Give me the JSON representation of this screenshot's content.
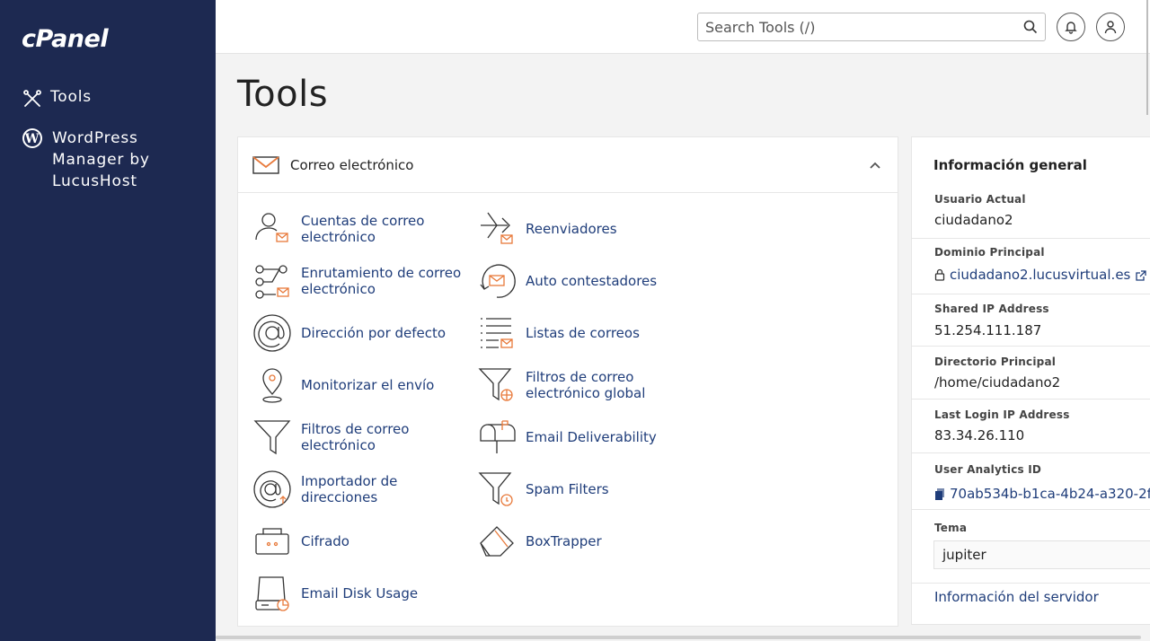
{
  "sidebar": {
    "logo": "cPanel",
    "items": [
      {
        "label": "Tools",
        "icon": "tools-icon"
      },
      {
        "label": "WordPress Manager by LucusHost",
        "icon": "wordpress-icon"
      }
    ]
  },
  "topbar": {
    "search_placeholder": "Search Tools (/)"
  },
  "page_title": "Tools",
  "email_section": {
    "title": "Correo electrónico",
    "tools": [
      {
        "label": "Cuentas de correo electrónico",
        "icon": "email-accounts-icon"
      },
      {
        "label": "Reenviadores",
        "icon": "forwarders-icon"
      },
      {
        "label": "Enrutamiento de correo electrónico",
        "icon": "email-routing-icon"
      },
      {
        "label": "Auto contestadores",
        "icon": "autoresponders-icon"
      },
      {
        "label": "Dirección por defecto",
        "icon": "default-address-icon"
      },
      {
        "label": "Listas de correos",
        "icon": "mailing-lists-icon"
      },
      {
        "label": "Monitorizar el envío",
        "icon": "track-delivery-icon"
      },
      {
        "label": "Filtros de correo electrónico global",
        "icon": "global-filters-icon"
      },
      {
        "label": "Filtros de correo electrónico",
        "icon": "email-filters-icon"
      },
      {
        "label": "Email Deliverability",
        "icon": "mailbox-icon"
      },
      {
        "label": "Importador de direcciones",
        "icon": "address-importer-icon"
      },
      {
        "label": "Spam Filters",
        "icon": "spam-filters-icon"
      },
      {
        "label": "Cifrado",
        "icon": "encryption-icon"
      },
      {
        "label": "BoxTrapper",
        "icon": "boxtrapper-icon"
      },
      {
        "label": "Email Disk Usage",
        "icon": "disk-usage-icon"
      }
    ]
  },
  "info": {
    "title": "Información general",
    "current_user_label": "Usuario Actual",
    "current_user": "ciudadano2",
    "primary_domain_label": "Dominio Principal",
    "primary_domain": "ciudadano2.lucusvirtual.es",
    "shared_ip_label": "Shared IP Address",
    "shared_ip": "51.254.111.187",
    "home_dir_label": "Directorio Principal",
    "home_dir": "/home/ciudadano2",
    "last_login_label": "Last Login IP Address",
    "last_login": "83.34.26.110",
    "analytics_label": "User Analytics ID",
    "analytics_id": "70ab534b-b1ca-4b24-a320-2f…",
    "theme_label": "Tema",
    "theme": "jupiter",
    "server_info": "Información del servidor"
  },
  "colors": {
    "sidebar_bg": "#1d2951",
    "link": "#1f3d7a",
    "accent_orange": "#e8793a"
  }
}
